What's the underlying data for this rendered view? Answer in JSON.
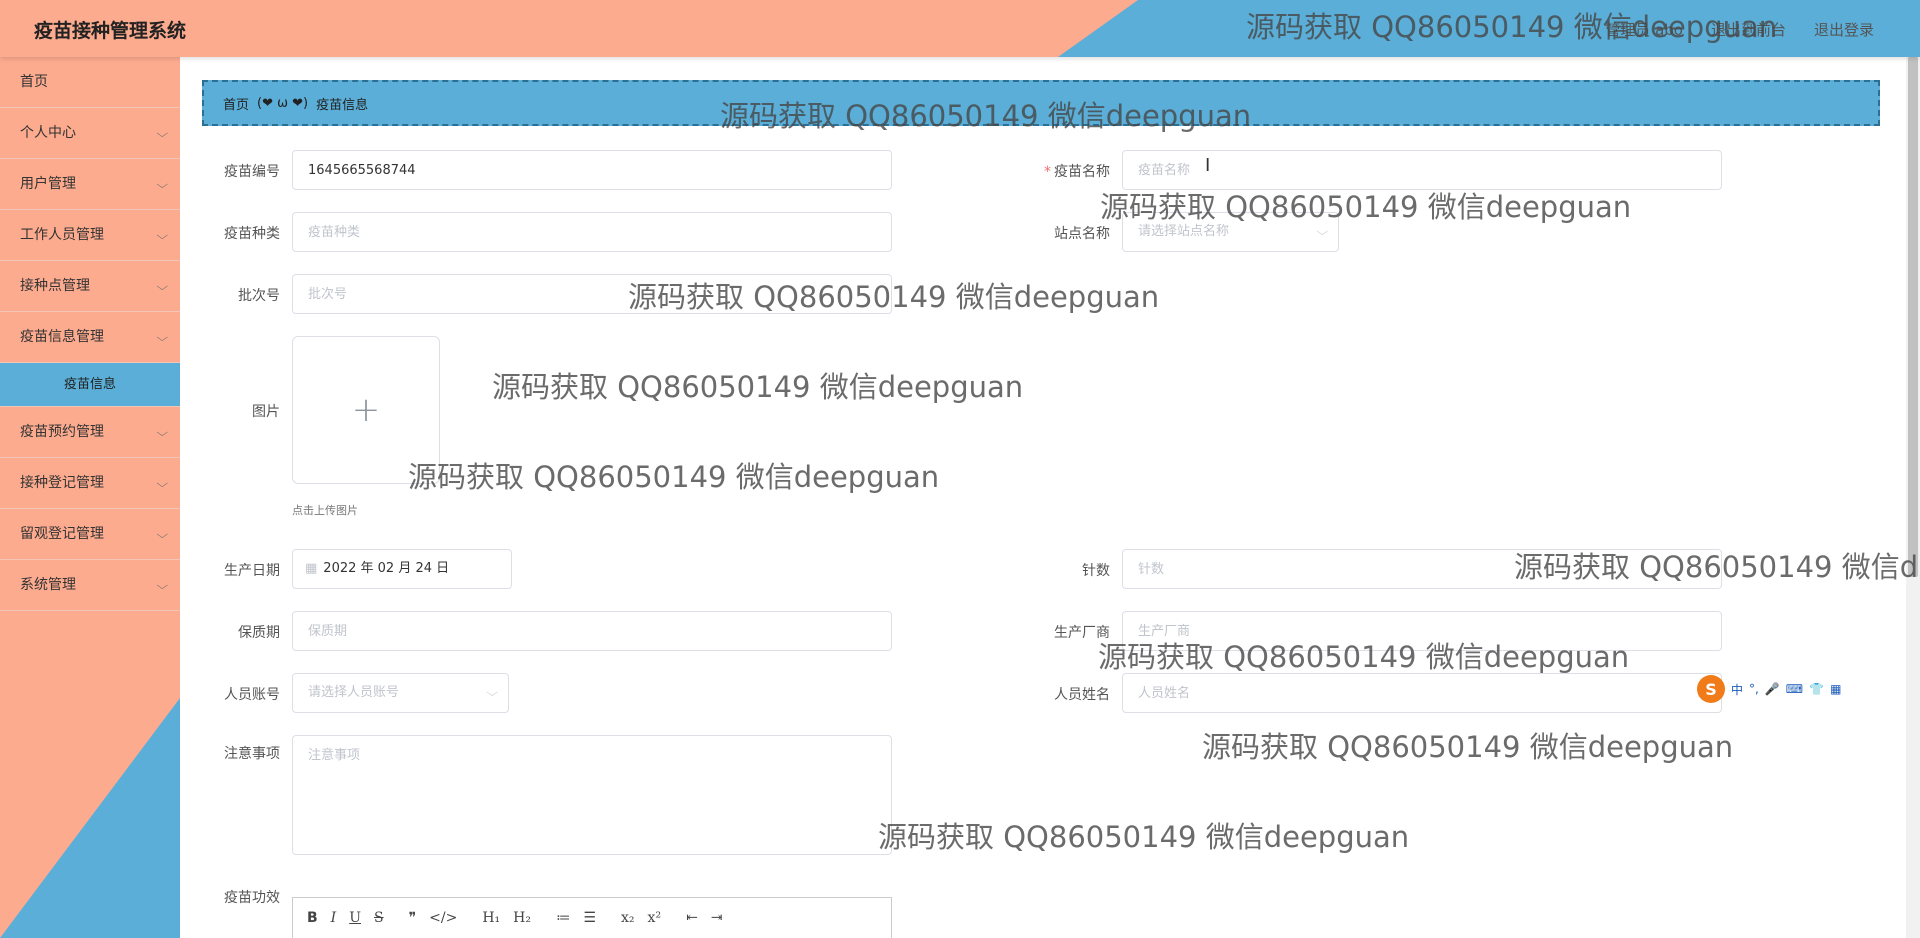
{
  "header": {
    "title": "疫苗接种管理系统",
    "user_info": "管理员 abo",
    "back_link": "退出到前台",
    "logout": "退出登录"
  },
  "sidebar": {
    "items": [
      {
        "label": "首页"
      },
      {
        "label": "个人中心"
      },
      {
        "label": "用户管理"
      },
      {
        "label": "工作人员管理"
      },
      {
        "label": "接种点管理"
      },
      {
        "label": "疫苗信息管理"
      },
      {
        "label": "疫苗信息"
      },
      {
        "label": "疫苗预约管理"
      },
      {
        "label": "接种登记管理"
      },
      {
        "label": "留观登记管理"
      },
      {
        "label": "系统管理"
      }
    ]
  },
  "breadcrumb": {
    "home": "首页",
    "separator": "(❤ ω ❤)",
    "current": "疫苗信息"
  },
  "form": {
    "vaccine_no": {
      "label": "疫苗编号",
      "value": "1645665568744"
    },
    "vaccine_name": {
      "label": "疫苗名称",
      "placeholder": "疫苗名称",
      "required": "*"
    },
    "vaccine_type": {
      "label": "疫苗种类",
      "placeholder": "疫苗种类"
    },
    "site_name": {
      "label": "站点名称",
      "placeholder": "请选择站点名称"
    },
    "batch_no": {
      "label": "批次号",
      "placeholder": "批次号"
    },
    "image": {
      "label": "图片",
      "plus": "+",
      "tip": "点击上传图片"
    },
    "production_date": {
      "label": "生产日期",
      "value": "2022 年 02 月 24 日"
    },
    "doses": {
      "label": "针数",
      "placeholder": "针数"
    },
    "shelf_life": {
      "label": "保质期",
      "placeholder": "保质期"
    },
    "manufacturer": {
      "label": "生产厂商",
      "placeholder": "生产厂商"
    },
    "staff_account": {
      "label": "人员账号",
      "placeholder": "请选择人员账号"
    },
    "staff_name": {
      "label": "人员姓名",
      "placeholder": "人员姓名"
    },
    "notes": {
      "label": "注意事项",
      "placeholder": "注意事项"
    },
    "efficacy": {
      "label": "疫苗功效"
    }
  },
  "editor_toolbar": [
    "B",
    "I",
    "U",
    "S",
    "❞",
    "</>",
    "H₁",
    "H₂",
    "≔",
    "☰",
    "x₂",
    "x²",
    "⇤",
    "⇥"
  ],
  "ime": {
    "logo": "S",
    "items": [
      "中",
      "°,",
      "🎤",
      "⌨",
      "👕",
      "▦"
    ]
  },
  "watermark": "源码获取 QQ86050149 微信deepguan",
  "watermark_cut": "源码获取 QQ86050149 微信d",
  "watermark_top": "源码获取 QQ86050149 微信deepguan"
}
